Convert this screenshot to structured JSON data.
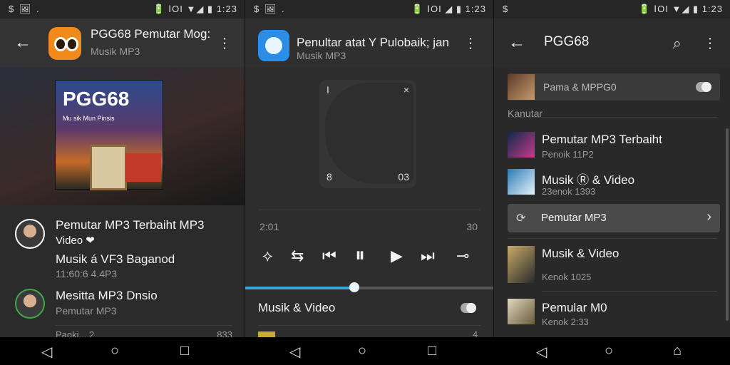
{
  "status_bar": {
    "p1_left": "$ 🖼 .",
    "p1_right": "🔋 ⅠΟΙ ▼◢ ▮ 1:23",
    "p2_left": "$ 🖼 .",
    "p2_right": "🔋 ⅠΟΙ ◢ ▮ 1:23",
    "p3_left": "$",
    "p3_right": "🔋 ⅠΟΙ ▼◢ ▮ 1:23"
  },
  "panel1": {
    "title": "PGG68 Pemutar Mog:",
    "subtitle": "Musik MP3",
    "cover_title": "PGG68",
    "cover_subtitle": "Mu sik Mun Pinsis",
    "items": [
      {
        "title": "Pemutar MP3 Terbaiht MP3",
        "subtitle": "Video ❤"
      },
      {
        "title": "Musik á VF3 Baganod",
        "subtitle": "11:60:6 4.4P3"
      },
      {
        "title": "Mesitta MP3 Dnsio",
        "subtitle": "Pemutar MP3"
      },
      {
        "title": "Paoki... 2",
        "subtitle": "",
        "trailing": "833"
      }
    ]
  },
  "panel2": {
    "title": "Penultar atat Y Pulobaik; jan",
    "subtitle": "Musik MP3",
    "art_tl": "I",
    "art_tr": "×",
    "art_bl": "8",
    "art_br": "03",
    "time_left": "2:01",
    "time_right": "30",
    "controls": [
      "⟡",
      "⇆",
      "⏮",
      "⏸",
      "▶",
      "⏭",
      "⊸"
    ],
    "section_label": "Musik & Video",
    "bottom_right": "4"
  },
  "panel3": {
    "title": "PGG68",
    "top_item": "Pama & MPPG0",
    "section_header": "Kanutar",
    "items": [
      {
        "title": "Pemutar MP3 Terbaiht",
        "subtitle": "Penoik 11P2"
      },
      {
        "title": "Musik Ⓡ & Video",
        "subtitle": "23enok 1393"
      },
      {
        "title": "Pemutar MP3",
        "subtitle": "",
        "highlighted": true
      },
      {
        "title": "Musik & Video",
        "subtitle": "Kenok 1025"
      },
      {
        "title": "Pemular M0",
        "subtitle": "Kenok 2:33"
      }
    ]
  },
  "icons": {
    "back": "←",
    "menu": "⋮",
    "search": "⌕",
    "chevron": "›",
    "sync": "⟳",
    "nav_back": "◁",
    "nav_home": "○",
    "nav_recent": "□",
    "nav_home_alt": "⌂"
  },
  "colors": {
    "accent": "#3aa8d8",
    "app_icon_orange": "#f08a1a",
    "app_icon_blue": "#2a8ee8"
  }
}
